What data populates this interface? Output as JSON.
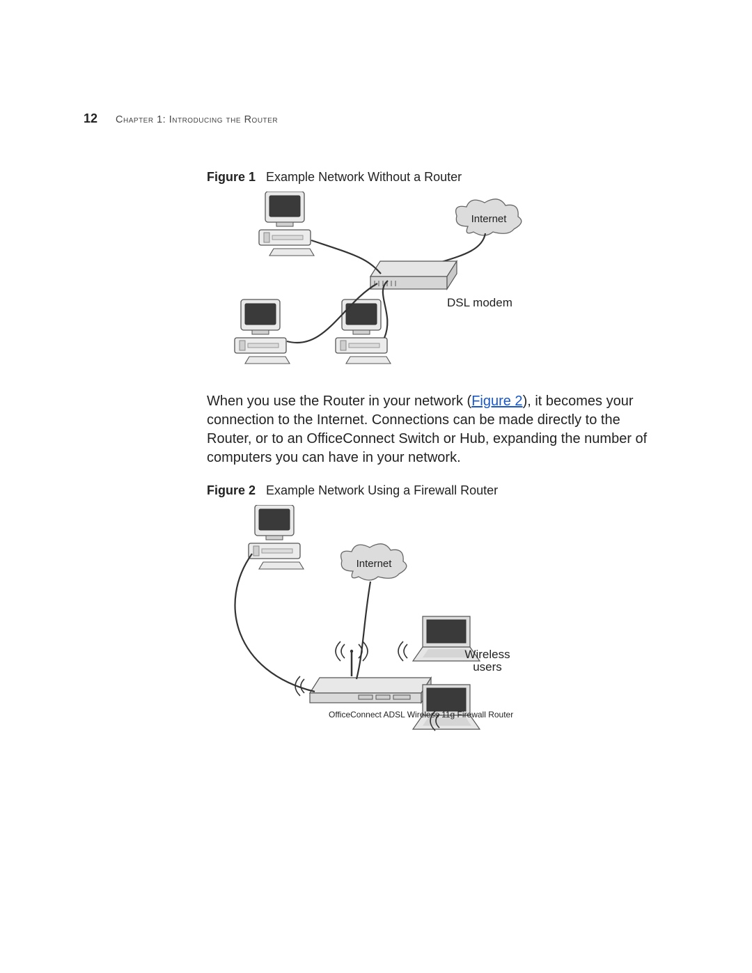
{
  "header": {
    "page_number": "12",
    "chapter_label": "Chapter 1: Introducing the Router"
  },
  "figure1": {
    "number_label": "Figure 1",
    "caption": "Example Network Without a Router",
    "labels": {
      "internet": "Internet",
      "dsl_modem": "DSL modem"
    }
  },
  "middle_paragraph": {
    "t1": "When you use the Router in your network (",
    "link": "Figure 2",
    "t2": "), it becomes your connection to the Internet. Connections can be made directly to the Router, or to an OfficeConnect Switch or Hub, expanding the number of computers you can have in your network."
  },
  "figure2": {
    "number_label": "Figure 2",
    "caption": "Example Network Using a Firewall Router",
    "labels": {
      "internet": "Internet",
      "router_name": "OfficeConnect ADSL Wireless 11g Firewall Router",
      "wireless_line1": "Wireless",
      "wireless_line2": "users"
    }
  }
}
